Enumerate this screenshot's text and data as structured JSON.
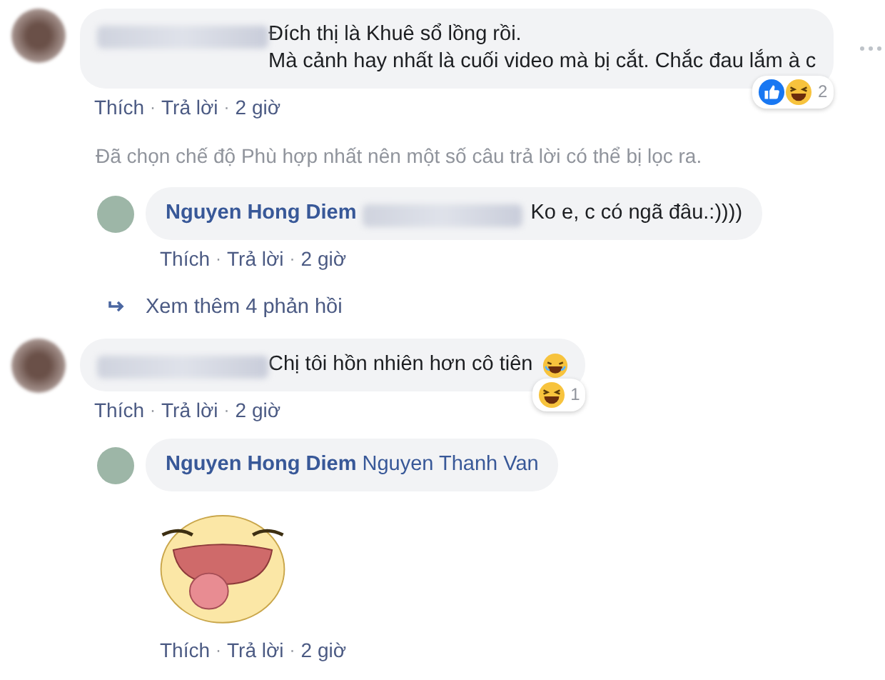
{
  "comments": [
    {
      "kind": "comment",
      "lines": [
        "Đích thị là Khuê sổ lồng rồi.",
        "Mà cảnh hay nhất là cuối video mà bị cắt. Chắc đau lắm à c"
      ],
      "emoji": false,
      "reactions": [
        {
          "kind": "like"
        },
        {
          "kind": "haha"
        }
      ],
      "reaction_count": "2",
      "actions": [
        "Thích",
        "Trả lời",
        "2 giờ"
      ],
      "separator": "·",
      "children": [
        {
          "kind": "notice",
          "text": "Đã chọn chế độ Phù hợp nhất nên một số câu trả lời có thể bị lọc ra."
        },
        {
          "kind": "reply",
          "author": "Nguyen Hong Diem",
          "text": "Ko e, c có ngã đâu.:))))",
          "sticker": false,
          "actions": [
            "Thích",
            "Trả lời",
            "2 giờ"
          ],
          "separator": "·"
        },
        {
          "kind": "more",
          "text": "Xem thêm 4 phản hồi"
        }
      ]
    },
    {
      "kind": "comment",
      "lines": [
        "Chị tôi hồn nhiên hơn cô tiên"
      ],
      "emoji": true,
      "reactions": [
        {
          "kind": "haha"
        }
      ],
      "reaction_count": "1",
      "actions": [
        "Thích",
        "Trả lời",
        "2 giờ"
      ],
      "separator": "·",
      "children": [
        {
          "kind": "reply",
          "author": "Nguyen Hong Diem",
          "mention": "Nguyen Thanh Van",
          "sticker": true,
          "actions": [
            "Thích",
            "Trả lời",
            "2 giờ"
          ],
          "separator": "·"
        }
      ]
    }
  ]
}
